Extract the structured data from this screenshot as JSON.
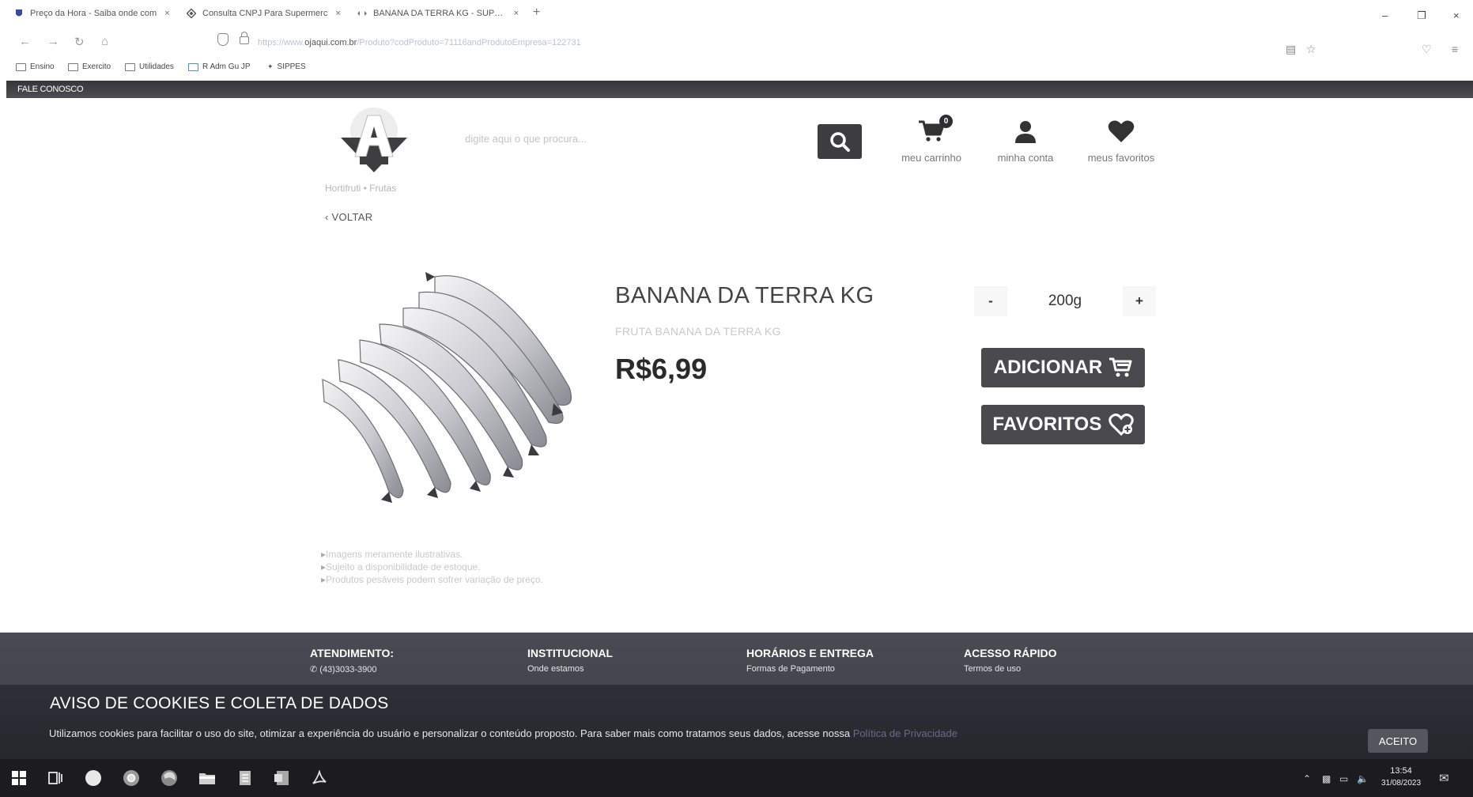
{
  "browser": {
    "tabs": [
      {
        "title": "Preço da Hora - Saiba onde com",
        "close": "×"
      },
      {
        "title": "Consulta CNPJ Para Supermerc",
        "close": "×"
      },
      {
        "title": "BANANA DA TERRA KG - SUPER",
        "close": "×"
      }
    ],
    "new_tab": "+",
    "window_controls": {
      "minimize": "–",
      "restore": "❐",
      "close": "×"
    },
    "nav": {
      "back": "←",
      "forward": "→",
      "reload": "↻",
      "home": "⌂"
    },
    "url": {
      "prefix": "https://www.",
      "domain": "ojaqui.com.br",
      "path": "/Produto?codProduto=71116andProdutoEmpresa=122731"
    },
    "bookmarks": [
      "Ensino",
      "Exercito",
      "Utilidades",
      "R Adm Gu JP",
      "SIPPES"
    ]
  },
  "site": {
    "top_bar": "FALE CONOSCO",
    "search_placeholder": "digite aqui o que procura...",
    "cart_count": "0",
    "cart_label": "meu carrinho",
    "account_label": "minha conta",
    "favorites_label": "meus favoritos",
    "breadcrumb": "Hortifruti • Frutas",
    "back_label": "‹ VOLTAR"
  },
  "product": {
    "title": "BANANA DA TERRA KG",
    "subtitle": "FRUTA BANANA DA TERRA KG",
    "price": "R$6,99",
    "quantity": "200g",
    "minus": "-",
    "plus": "+",
    "add_button": "ADICIONAR",
    "fav_button": "FAVORITOS",
    "notes": [
      "Imagens meramente ilustrativas.",
      "Sujeito a disponibilidade de estoque.",
      "Produtos pesáveis podem sofrer variação de preço."
    ]
  },
  "footer": {
    "columns": [
      {
        "heading": "ATENDIMENTO:",
        "link": "(43)3033-3900"
      },
      {
        "heading": "INSTITUCIONAL",
        "link": "Onde estamos"
      },
      {
        "heading": "HORÁRIOS E ENTREGA",
        "link": "Formas de Pagamento"
      },
      {
        "heading": "ACESSO RÁPIDO",
        "link": "Termos de uso"
      }
    ]
  },
  "cookie": {
    "title": "AVISO DE COOKIES E COLETA DE DADOS",
    "text": "Utilizamos cookies para facilitar o uso do site, otimizar a experiência do usuário e personalizar o conteúdo proposto. Para saber mais como tratamos seus dados, acesse nossa ",
    "policy_link": "Política de Privacidade",
    "accept": "ACEITO"
  },
  "taskbar": {
    "time": "13:54",
    "date": "31/08/2023"
  },
  "colors": {
    "dark_button": "#4a4a4e",
    "top_bar": "#3c3c42",
    "footer": "#44444c",
    "cookie_bg": "#2b2b32"
  }
}
